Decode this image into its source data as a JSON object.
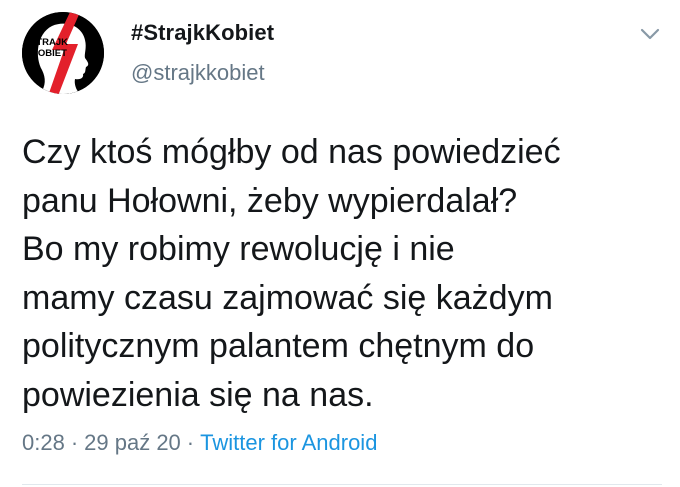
{
  "author": {
    "display_name": "#StrajkKobiet",
    "handle": "@strajkkobiet",
    "avatar_text_line1": "STRAJK",
    "avatar_text_line2": "KOBIET"
  },
  "tweet": {
    "lines": [
      "Czy ktoś mógłby od nas powiedzieć",
      "panu Hołowni, żeby wypierdalał?",
      "Bo my robimy rewolucję i nie",
      "mamy czasu zajmować się każdym",
      "politycznym palantem chętnym do",
      "powiezienia się na nas."
    ]
  },
  "meta": {
    "time": "0:28",
    "separator": "·",
    "date": "29 paź 20",
    "source": "Twitter for Android"
  },
  "icons": {
    "menu": "chevron-down-icon"
  },
  "colors": {
    "text": "#14171a",
    "secondary": "#657786",
    "link": "#1b95e0",
    "avatar_bg": "#000000",
    "bolt": "#e3202b"
  }
}
